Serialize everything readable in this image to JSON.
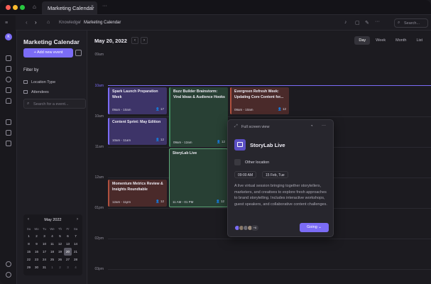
{
  "window": {
    "tab_title": "Marketing Calendar",
    "close": "×",
    "more": "···"
  },
  "toolbar": {
    "breadcrumb_1": "Knowledge",
    "breadcrumb_sep": "/",
    "breadcrumb_2": "Marketing Calendar",
    "search_placeholder": "Search..."
  },
  "sidebar": {
    "title": "Marketing Calendar",
    "add_button": "+ Add new event",
    "filter_label": "Filter by",
    "filters": [
      "Location Type",
      "Attendees"
    ],
    "search_placeholder": "Search for a event..."
  },
  "mini_cal": {
    "month": "May 2022",
    "weekdays": [
      "Su",
      "Mo",
      "Tu",
      "We",
      "Th",
      "Fr",
      "Sa"
    ],
    "weeks": [
      [
        "1",
        "2",
        "3",
        "4",
        "5",
        "6",
        "7"
      ],
      [
        "8",
        "9",
        "10",
        "11",
        "12",
        "13",
        "14"
      ],
      [
        "15",
        "16",
        "17",
        "18",
        "19",
        "20",
        "21"
      ],
      [
        "22",
        "23",
        "24",
        "25",
        "26",
        "27",
        "28"
      ],
      [
        "29",
        "30",
        "31",
        "1",
        "2",
        "3",
        "4"
      ]
    ],
    "selected": "20"
  },
  "header": {
    "date": "May 20, 2022",
    "views": [
      "Day",
      "Week",
      "Month",
      "List"
    ],
    "active_view": "Day"
  },
  "times": [
    "09am",
    "10am",
    "11am",
    "12am",
    "01pm",
    "02pm",
    "03pm"
  ],
  "now_label": "10am",
  "events": [
    {
      "title": "Spark Launch Preparation Week",
      "time": "09am - 10am",
      "count": "17",
      "color": "#3d3468"
    },
    {
      "title": "Buzz Builder Brainstorm: Viral Ideas & Audience Hooks",
      "time": "09am - 12am",
      "count": "12",
      "color": "#284034"
    },
    {
      "title": "Evergreen Refresh Week: Updating Core Content for...",
      "time": "09am - 10am",
      "count": "12",
      "color": "#4a2a2a"
    },
    {
      "title": "Content Sprint: May Edition",
      "time": "10am - 11am",
      "count": "12",
      "color": "#3d3468"
    },
    {
      "title": "StoryLab Live",
      "time": "11 AM - 01 PM",
      "count": "12",
      "color": "#284034"
    },
    {
      "title": "Momentum Metrics Review & Insights Roundtable",
      "time": "12am - 11pm",
      "count": "12",
      "color": "#4a2a2a"
    }
  ],
  "popup": {
    "fullscreen": "Full screen view",
    "title": "StoryLab Live",
    "location": "Other location",
    "time_chip": "09:00 AM",
    "date_chip": "15 Feb, Tue",
    "description": "A live virtual session bringing together storytellers, marketers, and creatives to explore fresh approaches to brand storytelling. Includes interactive workshops, guest speakers, and collaborative content challenges.",
    "more_attendees": "+6",
    "going": "Going"
  },
  "colors": {
    "accent": "#7b6cf6"
  }
}
